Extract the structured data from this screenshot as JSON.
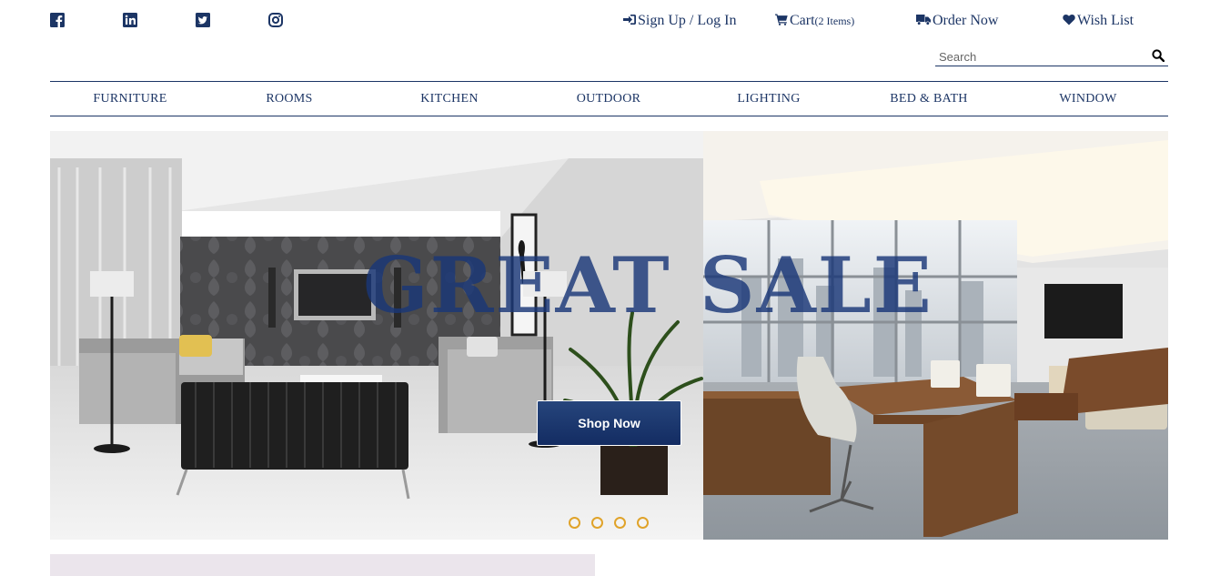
{
  "social": [
    {
      "name": "facebook-icon"
    },
    {
      "name": "linkedin-icon"
    },
    {
      "name": "twitter-icon"
    },
    {
      "name": "instagram-icon"
    }
  ],
  "header": {
    "signup_label": "Sign Up / Log In",
    "cart_label": "Cart",
    "cart_count": "(2 Items)",
    "order_label": "Order Now",
    "wishlist_label": "Wish List"
  },
  "search": {
    "placeholder": "Search"
  },
  "categories": [
    "FURNITURE",
    "ROOMS",
    "KITCHEN",
    "OUTDOOR",
    "LIGHTING",
    "BED & BATH",
    "WINDOW"
  ],
  "hero": {
    "headline": "GREAT SALE",
    "cta_label": "Shop Now",
    "slide_count": 4
  },
  "colors": {
    "brand": "#1c3565",
    "accent": "#e0a32a"
  }
}
